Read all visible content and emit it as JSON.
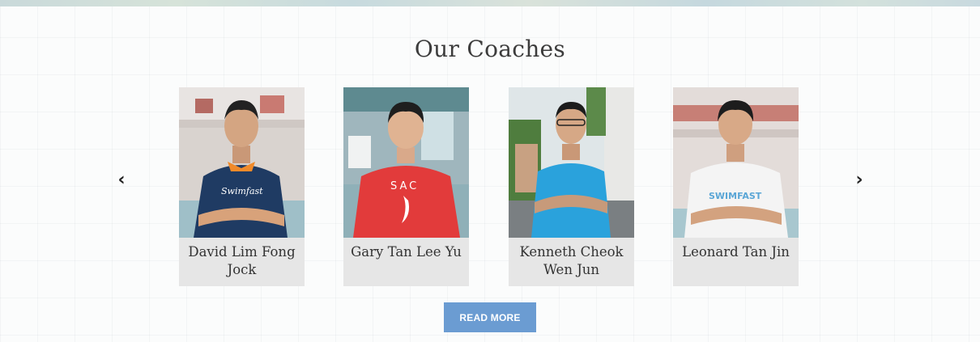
{
  "section": {
    "title": "Our Coaches"
  },
  "carousel": {
    "prev_icon": "chevron-left-icon",
    "next_icon": "chevron-right-icon",
    "prev_glyph": "‹",
    "next_glyph": "›"
  },
  "coaches": [
    {
      "name": "David Lim Fong Jock",
      "shirt_text": "Swimfast",
      "shirt_color": "#1f3b63"
    },
    {
      "name": "Gary Tan Lee Yu",
      "shirt_text": "SAC",
      "shirt_color": "#e23b3b"
    },
    {
      "name": "Kenneth Cheok Wen Jun",
      "shirt_text": "",
      "shirt_color": "#2aa2dc"
    },
    {
      "name": "Leonard Tan Jin",
      "shirt_text": "SWIMFAST",
      "shirt_color": "#f4f4f4"
    }
  ],
  "cta": {
    "read_more_label": "READ MORE",
    "color": "#6b9cd2"
  }
}
